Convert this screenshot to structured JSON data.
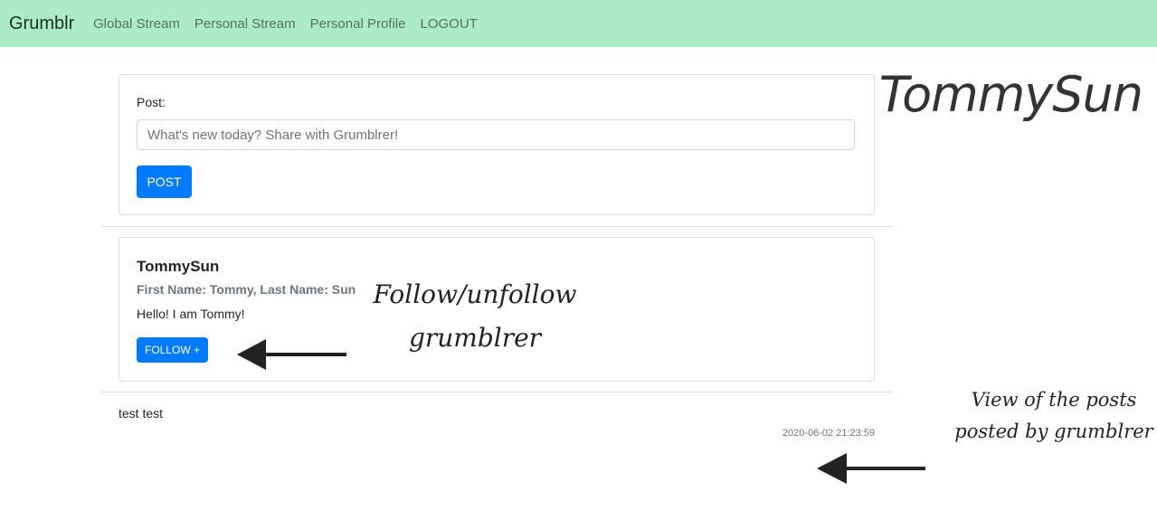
{
  "navbar": {
    "brand": "Grumblr",
    "links": [
      {
        "label": "Global Stream"
      },
      {
        "label": "Personal Stream"
      },
      {
        "label": "Personal Profile"
      },
      {
        "label": "LOGOUT"
      }
    ],
    "background_color": "#abebc6"
  },
  "post_form": {
    "label": "Post:",
    "placeholder": "What's new today? Share with Grumblrer!",
    "value": "",
    "button_label": "POST"
  },
  "profile": {
    "username": "TommySun",
    "names": "First Name: Tommy, Last Name: Sun",
    "bio": "Hello! I am Tommy!",
    "follow_button_label": "FOLLOW +"
  },
  "posts": [
    {
      "text": "test test",
      "timestamp": "2020-06-02 21:23:59"
    }
  ],
  "sidebar": {
    "username": "TommySun"
  },
  "annotations": {
    "follow": [
      "Follow/unfollow",
      "grumblrer"
    ],
    "view": [
      "View of the posts",
      "posted by grumblrer"
    ]
  },
  "colors": {
    "primary": "#007bff",
    "navbar": "#abebc6",
    "muted": "#6c757d"
  }
}
